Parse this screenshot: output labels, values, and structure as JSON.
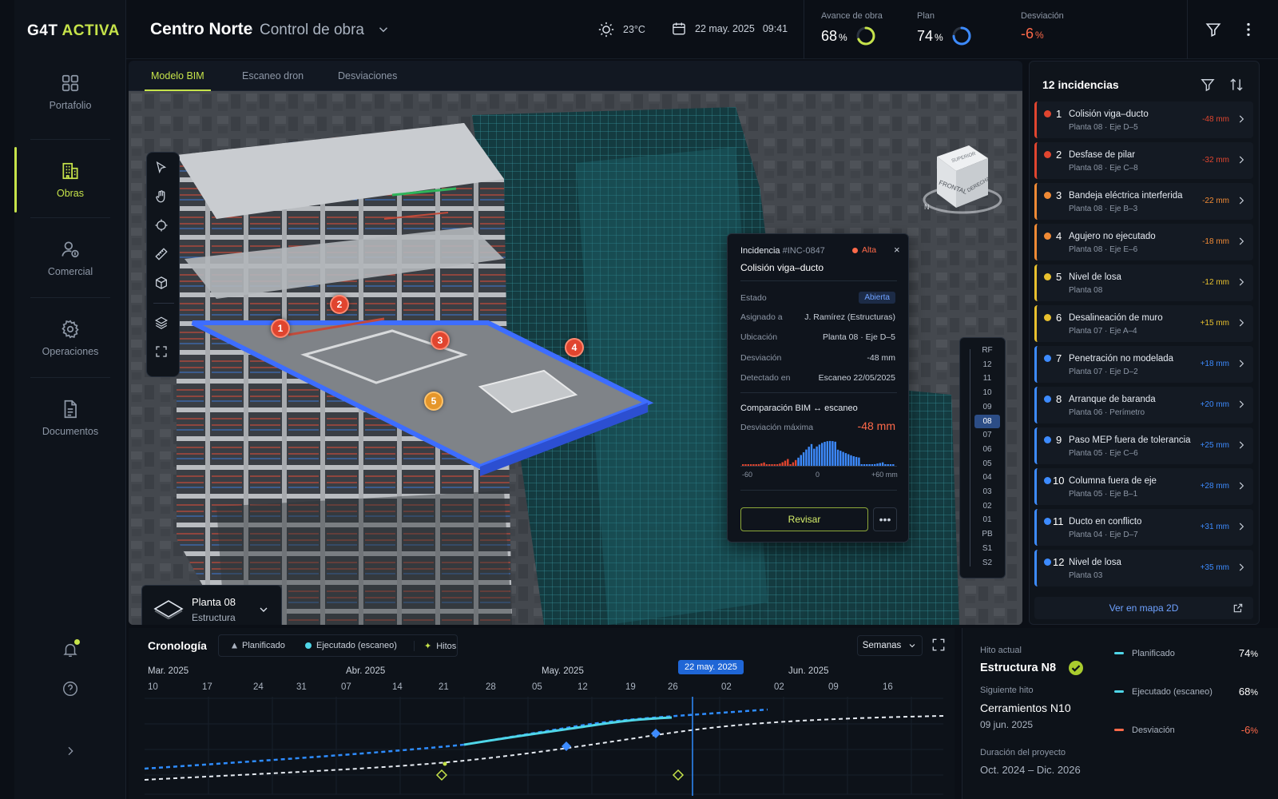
{
  "brand": {
    "name": "G4T",
    "accent": "ACTIVA",
    "accent_color": "#c6e34a"
  },
  "sidebar": {
    "items": [
      {
        "label": "Portafolio",
        "icon": "grid-icon",
        "active": false
      },
      {
        "label": "Obras",
        "icon": "building-icon",
        "active": true
      },
      {
        "label": "Comercial",
        "icon": "user-money-icon",
        "active": false
      },
      {
        "label": "Operaciones",
        "icon": "gear-icon",
        "active": false
      },
      {
        "label": "Documentos",
        "icon": "document-icon",
        "active": false
      }
    ],
    "bottom_icons": [
      "bell-icon",
      "help-icon",
      "chevron-right-icon"
    ]
  },
  "header": {
    "project": "Centro Norte",
    "separator": "·",
    "section": "Control de obra",
    "weather": "23°C",
    "date": "22 may. 2025",
    "time": "09:41",
    "kpis": [
      {
        "label": "Avance de obra",
        "value": "68",
        "unit": "%",
        "progress": 0.68,
        "color": "#c6e34a"
      },
      {
        "label": "Plan",
        "value": "74",
        "unit": "%",
        "progress": 0.74,
        "color": "#3d8bff"
      },
      {
        "label": "Desviación",
        "value": "-6",
        "unit": "%",
        "color": "#ff6a4a"
      }
    ]
  },
  "viewer": {
    "tabs": [
      {
        "label": "Modelo BIM",
        "active": true
      },
      {
        "label": "Escaneo dron",
        "active": false
      },
      {
        "label": "Desviaciones",
        "active": false
      }
    ],
    "tools": [
      "cursor-icon",
      "hand-icon",
      "orbit-icon",
      "ruler-icon",
      "cube-icon",
      "layers-icon",
      "fullscreen-icon"
    ],
    "viewcube": {
      "top": "SUPERIOR",
      "front": "FRONTAL",
      "right": "DERECHA",
      "compass": "N"
    },
    "markers": [
      "1",
      "2",
      "3",
      "4",
      "5"
    ],
    "floor": {
      "name": "Planta 08",
      "layer": "Estructura"
    },
    "levels": [
      "RF",
      "12",
      "11",
      "10",
      "09",
      "08",
      "07",
      "06",
      "05",
      "04",
      "03",
      "02",
      "01",
      "PB",
      "S1",
      "S2"
    ],
    "active_level": "08"
  },
  "incident": {
    "title": "Incidencia",
    "id": "#INC-0847",
    "priority": "Alta",
    "name": "Colisión viga–ducto",
    "fields": [
      {
        "label": "Estado",
        "value": "Abierta"
      },
      {
        "label": "Asignado a",
        "value": "J. Ramírez (Estructuras)"
      },
      {
        "label": "Ubicación",
        "value": "Planta 08 · Eje D–5"
      },
      {
        "label": "Desviación",
        "value": "-48 mm"
      },
      {
        "label": "Detectado en",
        "value": "Escaneo 22/05/2025"
      }
    ],
    "comparison_title": "Comparación BIM ↔ escaneo",
    "max_label": "Desviación máxima",
    "max_value": "-48 mm",
    "axis": [
      "-60",
      "0",
      "+60 mm"
    ],
    "review_button": "Revisar"
  },
  "incidents_panel": {
    "title": "12 incidencias",
    "items": [
      {
        "num": "1",
        "name": "Colisión viga–ducto",
        "loc": "Planta 08 · Eje D–5",
        "dev": "-48 mm",
        "color": "#e0452f"
      },
      {
        "num": "2",
        "name": "Desfase de pilar",
        "loc": "Planta 08 · Eje C–8",
        "dev": "-32 mm",
        "color": "#e0452f"
      },
      {
        "num": "3",
        "name": "Bandeja eléctrica interferida",
        "loc": "Planta 08 · Eje B–3",
        "dev": "-22 mm",
        "color": "#f08a35"
      },
      {
        "num": "4",
        "name": "Agujero no ejecutado",
        "loc": "Planta 08 · Eje E–6",
        "dev": "-18 mm",
        "color": "#f08a35"
      },
      {
        "num": "5",
        "name": "Nivel de losa",
        "loc": "Planta 08",
        "dev": "-12 mm",
        "color": "#e8c02e"
      },
      {
        "num": "6",
        "name": "Desalineación de muro",
        "loc": "Planta 07 · Eje A–4",
        "dev": "+15 mm",
        "color": "#e8c02e"
      },
      {
        "num": "7",
        "name": "Penetración no modelada",
        "loc": "Planta 07 · Eje D–2",
        "dev": "+18 mm",
        "color": "#3d8bff"
      },
      {
        "num": "8",
        "name": "Arranque de baranda",
        "loc": "Planta 06 · Perímetro",
        "dev": "+20 mm",
        "color": "#3d8bff"
      },
      {
        "num": "9",
        "name": "Paso MEP fuera de tolerancia",
        "loc": "Planta 05 · Eje C–6",
        "dev": "+25 mm",
        "color": "#3d8bff"
      },
      {
        "num": "10",
        "name": "Columna fuera de eje",
        "loc": "Planta 05 · Eje B–1",
        "dev": "+28 mm",
        "color": "#3d8bff"
      },
      {
        "num": "11",
        "name": "Ducto en conflicto",
        "loc": "Planta 04 · Eje D–7",
        "dev": "+31 mm",
        "color": "#3d8bff"
      },
      {
        "num": "12",
        "name": "Nivel de losa",
        "loc": "Planta 03",
        "dev": "+35 mm",
        "color": "#3d8bff"
      }
    ],
    "map_link": "Ver en mapa 2D"
  },
  "timeline": {
    "title": "Cronología",
    "legend": [
      "Planificado",
      "Ejecutado (escaneo)",
      "Hitos"
    ],
    "scale": "Semanas",
    "months": [
      "Mar. 2025",
      "Abr. 2025",
      "May. 2025",
      "Jun. 2025"
    ],
    "days": [
      "10",
      "17",
      "24",
      "31",
      "07",
      "14",
      "21",
      "28",
      "05",
      "12",
      "19",
      "26",
      "02",
      "02",
      "09",
      "16"
    ],
    "today": "22 may. 2025"
  },
  "milestones": {
    "current_label": "Hito actual",
    "current": "Estructura N8",
    "next_label": "Siguiente hito",
    "next": "Cerramientos N10",
    "next_date": "09 jun. 2025",
    "duration_label": "Duración del proyecto",
    "duration": "Oct. 2024 – Dic. 2026",
    "stats": [
      {
        "label": "Planificado",
        "value": "74",
        "unit": "%",
        "color": "#4fd6e8"
      },
      {
        "label": "Ejecutado (escaneo)",
        "value": "68",
        "unit": "%",
        "color": "#4fd6e8"
      },
      {
        "label": "Desviación",
        "value": "-6",
        "unit": "%",
        "color": "#ff6a4a"
      }
    ]
  }
}
